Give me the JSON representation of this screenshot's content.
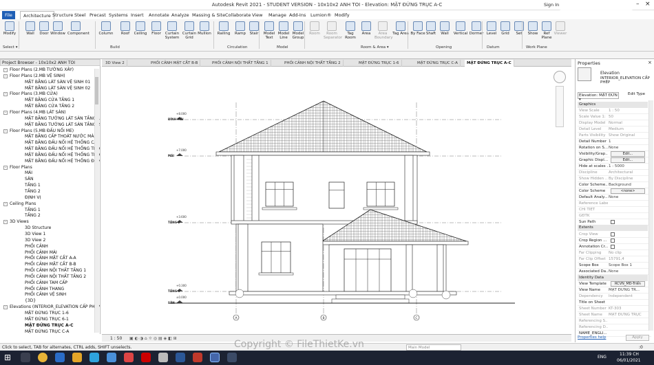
{
  "window": {
    "title": "Autodesk Revit 2021 - STUDENT VERSION - 10x10x2 ANH TOI - Elevation: MẶT ĐỨNG TRỤC A-C",
    "sign_in": "Sign In"
  },
  "logo": {
    "text": "File Thiết Kế .vn"
  },
  "ribbon_tabs": [
    "File",
    "Architecture",
    "Structure",
    "Steel",
    "Precast",
    "Systems",
    "Insert",
    "Annotate",
    "Analyze",
    "Massing & Site",
    "Collaborate",
    "View",
    "Manage",
    "Add-Ins",
    "Lumion®",
    "Modify"
  ],
  "ribbon": {
    "select_label": "Select ▾",
    "groups": {
      "build": "Build",
      "circulation": "Circulation",
      "model": "Model",
      "room_area": "Room & Area ▾",
      "opening": "Opening",
      "datum": "Datum",
      "work_plane": "Work Plane"
    },
    "tools": [
      {
        "label": "Modify",
        "enabled": true
      },
      {
        "label": "Wall",
        "enabled": true
      },
      {
        "label": "Door",
        "enabled": true
      },
      {
        "label": "Window",
        "enabled": true
      },
      {
        "label": "Component",
        "enabled": true
      },
      {
        "label": "Column",
        "enabled": true
      },
      {
        "label": "Roof",
        "enabled": true
      },
      {
        "label": "Ceiling",
        "enabled": true
      },
      {
        "label": "Floor",
        "enabled": true
      },
      {
        "label": "Curtain System",
        "enabled": true
      },
      {
        "label": "Curtain Grid",
        "enabled": true
      },
      {
        "label": "Mullion",
        "enabled": true
      },
      {
        "label": "Railing",
        "enabled": true
      },
      {
        "label": "Ramp",
        "enabled": true
      },
      {
        "label": "Stair",
        "enabled": true
      },
      {
        "label": "Model Text",
        "enabled": true
      },
      {
        "label": "Model Line",
        "enabled": true
      },
      {
        "label": "Model Group",
        "enabled": true
      },
      {
        "label": "Room",
        "enabled": false
      },
      {
        "label": "Room Separator",
        "enabled": false
      },
      {
        "label": "Tag Room",
        "enabled": true
      },
      {
        "label": "Area",
        "enabled": true
      },
      {
        "label": "Area Boundary",
        "enabled": false
      },
      {
        "label": "Tag Area",
        "enabled": true
      },
      {
        "label": "By Face",
        "enabled": true
      },
      {
        "label": "Shaft",
        "enabled": true
      },
      {
        "label": "Wall",
        "enabled": true
      },
      {
        "label": "Vertical",
        "enabled": true
      },
      {
        "label": "Dormer",
        "enabled": true
      },
      {
        "label": "Level",
        "enabled": true
      },
      {
        "label": "Grid",
        "enabled": true
      },
      {
        "label": "Set",
        "enabled": true
      },
      {
        "label": "Show",
        "enabled": true
      },
      {
        "label": "Ref Plane",
        "enabled": true
      },
      {
        "label": "Viewer",
        "enabled": false
      }
    ]
  },
  "project_browser": {
    "header": "Project Browser - 10x10x2 ANH TOI",
    "items": [
      {
        "text": "Floor Plans (2.MB TƯỜNG XÂY)",
        "level": 1,
        "exp": "-"
      },
      {
        "text": "Floor Plans (2.MB VỆ SINH)",
        "level": 1,
        "exp": "-"
      },
      {
        "text": "MẶT BẰNG LÁT SÀN VỆ SINH 01",
        "level": 2
      },
      {
        "text": "MẶT BẰNG LÁT SÀN VỆ SINH 02",
        "level": 2
      },
      {
        "text": "Floor Plans (3.MB CỬA)",
        "level": 1,
        "exp": "-"
      },
      {
        "text": "MẶT BẰNG CỬA TẦNG 1",
        "level": 2
      },
      {
        "text": "MẶT BẰNG CỬA TẦNG 2",
        "level": 2
      },
      {
        "text": "Floor Plans (4.MB LÁT SÀN)",
        "level": 1,
        "exp": "-"
      },
      {
        "text": "MẶT BẰNG TƯỜNG LÁT SÀN TẦNG 1",
        "level": 2
      },
      {
        "text": "MẶT BẰNG TƯỜNG LÁT SÀN TẦNG 2",
        "level": 2
      },
      {
        "text": "Floor Plans (5.MB ĐẤU NỐI ME)",
        "level": 1,
        "exp": "-"
      },
      {
        "text": "MẶT BẰNG CẤP THOÁT NƯỚC MÁI",
        "level": 2
      },
      {
        "text": "MẶT BẰNG ĐẤU NỐI HỆ THỐNG CẤP N",
        "level": 2
      },
      {
        "text": "MẶT BẰNG ĐẤU NỐI HỆ THỐNG THOÁ",
        "level": 2
      },
      {
        "text": "MẶT BẰNG ĐẤU NỐI HỆ THỐNG THÔN",
        "level": 2
      },
      {
        "text": "MẶT BẰNG ĐẤU NỐI HỆ THỐNG ĐIỆN",
        "level": 2
      },
      {
        "text": "Floor Plans",
        "level": 1,
        "exp": "-"
      },
      {
        "text": "MÁI",
        "level": 2
      },
      {
        "text": "SÂN",
        "level": 2
      },
      {
        "text": "TẦNG 1",
        "level": 2
      },
      {
        "text": "TẦNG 2",
        "level": 2
      },
      {
        "text": "ĐỊNH VỊ",
        "level": 2
      },
      {
        "text": "Ceiling Plans",
        "level": 1,
        "exp": "-"
      },
      {
        "text": "TẦNG 1",
        "level": 2
      },
      {
        "text": "TẦNG 2",
        "level": 2
      },
      {
        "text": "3D Views",
        "level": 1,
        "exp": "-"
      },
      {
        "text": "3D Structure",
        "level": 2
      },
      {
        "text": "3D View 1",
        "level": 2
      },
      {
        "text": "3D View 2",
        "level": 2
      },
      {
        "text": "PHỐI CẢNH",
        "level": 2
      },
      {
        "text": "PHỐI CẢNH MÁI",
        "level": 2
      },
      {
        "text": "PHỐI CẢNH MẶT CẮT A-A",
        "level": 2
      },
      {
        "text": "PHỐI CẢNH MẶT CẮT B-B",
        "level": 2
      },
      {
        "text": "PHỐI CẢNH NỘI THẤT TẦNG 1",
        "level": 2
      },
      {
        "text": "PHỐI CẢNH NỘI THẤT TẦNG 2",
        "level": 2
      },
      {
        "text": "PHỐI CẢNH TAM CẤP",
        "level": 2
      },
      {
        "text": "PHỐI CẢNH THANG",
        "level": 2
      },
      {
        "text": "PHỐI CẢNH VỆ SINH",
        "level": 2
      },
      {
        "text": "{3D}",
        "level": 2
      },
      {
        "text": "Elevations (INTERIOR_ELEVATION CẤP PHÉP",
        "level": 1,
        "exp": "-"
      },
      {
        "text": "MẶT ĐỨNG TRỤC 1-6",
        "level": 2
      },
      {
        "text": "MẶT ĐỨNG TRỤC 6-1",
        "level": 2
      },
      {
        "text": "MẶT ĐỨNG TRỤC A-C",
        "level": 2,
        "bold": true
      },
      {
        "text": "MẶT ĐỨNG TRỤC C-A",
        "level": 2
      }
    ]
  },
  "view_tabs": [
    {
      "label": "3D View 2",
      "active": false
    },
    {
      "label": "PHỐI CẢNH MẶT CẮT B-B",
      "active": false
    },
    {
      "label": "PHỐI CẢNH NỘI THẤT TẦNG 1",
      "active": false
    },
    {
      "label": "PHỐI CẢNH NỘI THẤT TẦNG 2",
      "active": false
    },
    {
      "label": "MẶT ĐỨNG TRỤC 1-6",
      "active": false
    },
    {
      "label": "MẶT ĐỨNG TRỤC C-A",
      "active": false
    },
    {
      "label": "MẶT ĐỨNG TRỤC A-C",
      "active": true
    }
  ],
  "drawing": {
    "levels": [
      {
        "elev": "+8.000",
        "name": "ĐỈNH MÁI"
      },
      {
        "elev": "+7.000",
        "name": "MÁI"
      },
      {
        "elev": "+3.600",
        "name": "TẦNG 2"
      },
      {
        "elev": "+0.300",
        "name": "TẦNG 1"
      },
      {
        "elev": "±0.000",
        "name": "SÂN"
      }
    ],
    "grids": [
      "A",
      "B",
      "C"
    ]
  },
  "properties": {
    "title": "Properties",
    "type_name": "Elevation",
    "type_sub": "INTERIOR_ELEVATION CẤP PHÉP",
    "selector": "Elevation: MẶT ĐỨN ▾",
    "edit_type": "Edit Type",
    "sections": [
      {
        "name": "Graphics",
        "rows": [
          {
            "k": "View Scale",
            "v": "1 : 50",
            "grey": true
          },
          {
            "k": "Scale Value    1:",
            "v": "50",
            "grey": true
          },
          {
            "k": "Display Model",
            "v": "Normal",
            "grey": true
          },
          {
            "k": "Detail Level",
            "v": "Medium",
            "grey": true
          },
          {
            "k": "Parts Visibility",
            "v": "Show Original",
            "grey": true
          },
          {
            "k": "Detail Number",
            "v": "1"
          },
          {
            "k": "Rotation on S...",
            "v": "None"
          },
          {
            "k": "Visibility/Grap...",
            "v": "Edit...",
            "btn": true
          },
          {
            "k": "Graphic Displ...",
            "v": "Edit...",
            "btn": true
          },
          {
            "k": "Hide at scales ...",
            "v": "1 : 5000"
          },
          {
            "k": "Discipline",
            "v": "Architectural",
            "grey": true
          },
          {
            "k": "Show Hidden ...",
            "v": "By Discipline",
            "grey": true
          },
          {
            "k": "Color Scheme...",
            "v": "Background"
          },
          {
            "k": "Color Scheme",
            "v": "<none>",
            "btn": true
          },
          {
            "k": "Default Analy...",
            "v": "None"
          },
          {
            "k": "Reference Label",
            "v": "",
            "grey": true
          },
          {
            "k": "CHI TIẾT",
            "v": "",
            "grey": true
          },
          {
            "k": "GĐTK",
            "v": "",
            "grey": true
          },
          {
            "k": "Sun Path",
            "v": "",
            "cb": true
          }
        ]
      },
      {
        "name": "Extents",
        "rows": [
          {
            "k": "Crop View",
            "v": "",
            "cb": true,
            "grey": true
          },
          {
            "k": "Crop Region ...",
            "v": "",
            "cb": true
          },
          {
            "k": "Annotation Cr...",
            "v": "",
            "cb": true
          },
          {
            "k": "Far Clipping",
            "v": "No clip",
            "grey": true
          },
          {
            "k": "Far Clip Offset",
            "v": "15791,4",
            "grey": true
          },
          {
            "k": "Scope Box",
            "v": "Scope Box 1"
          },
          {
            "k": "Associated Da...",
            "v": "None"
          }
        ]
      },
      {
        "name": "Identity Data",
        "rows": [
          {
            "k": "View Template",
            "v": "RCVN_MĐ-Triển",
            "btn": true
          },
          {
            "k": "View Name",
            "v": "MẶT ĐỨNG TR..."
          },
          {
            "k": "Dependency",
            "v": "Independent",
            "grey": true
          },
          {
            "k": "Title on Sheet",
            "v": ""
          },
          {
            "k": "Sheet Number",
            "v": "KT-303",
            "grey": true
          },
          {
            "k": "Sheet Name",
            "v": "MẶT ĐỨNG TRỤC",
            "grey": true
          },
          {
            "k": "Referencing S...",
            "v": "",
            "grey": true
          },
          {
            "k": "Referencing D...",
            "v": "",
            "grey": true
          },
          {
            "k": "NAME_ENGLI...",
            "v": ""
          }
        ]
      }
    ],
    "help": "Properties help",
    "apply": "Apply"
  },
  "view_control": {
    "scale": "1 : 50",
    "design_option": "Main Model"
  },
  "status": {
    "text": "Click to select, TAB for alternates, CTRL adds, SHIFT unselects.",
    "filter": ":0"
  },
  "watermark": "Copyright © FileThietKe.vn",
  "taskbar": {
    "time": "11:39 CH",
    "date": "06/01/2021",
    "lang": "ENG"
  }
}
